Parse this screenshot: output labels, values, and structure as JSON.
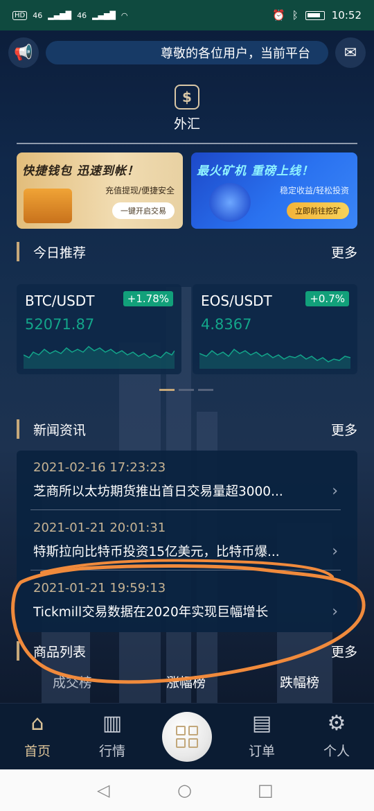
{
  "status_bar": {
    "left": [
      "HD",
      "46",
      "46"
    ],
    "time": "10:52"
  },
  "notice": {
    "text": "尊敬的各位用户，当前平台",
    "left_icon": "megaphone-icon",
    "right_icon": "mail-icon"
  },
  "forex": {
    "icon": "dollar-exchange-icon",
    "label": "外汇"
  },
  "banners": [
    {
      "headline": "快捷钱包 迅速到帐！",
      "subtitle": "充值提现/便捷安全",
      "cta": "一键开启交易"
    },
    {
      "headline": "最火矿机 重磅上线！",
      "subtitle": "稳定收益/轻松投资",
      "cta": "立即前往挖矿"
    }
  ],
  "recommend": {
    "title": "今日推荐",
    "more": "更多"
  },
  "tickers": [
    {
      "pair": "BTC/USDT",
      "change": "+1.78%",
      "price": "52071.87"
    },
    {
      "pair": "EOS/USDT",
      "change": "+0.7%",
      "price": "4.8367"
    }
  ],
  "news": {
    "title": "新闻资讯",
    "more": "更多",
    "items": [
      {
        "time": "2021-02-16 17:23:23",
        "headline": "芝商所以太坊期货推出首日交易量超3000..."
      },
      {
        "time": "2021-01-21 20:01:31",
        "headline": "特斯拉向比特币投资15亿美元，比特币爆..."
      },
      {
        "time": "2021-01-21 19:59:13",
        "headline": "Tickmill交易数据在2020年实现巨幅增长"
      }
    ]
  },
  "products": {
    "title": "商品列表",
    "more": "更多",
    "tabs": [
      "成交榜",
      "涨幅榜",
      "跌幅榜"
    ]
  },
  "tabbar": [
    {
      "label": "首页",
      "icon": "home-icon",
      "active": true
    },
    {
      "label": "行情",
      "icon": "chart-bars-icon",
      "active": false
    },
    {
      "label": "",
      "icon": "grid-icon",
      "active": false
    },
    {
      "label": "订单",
      "icon": "document-icon",
      "active": false
    },
    {
      "label": "个人",
      "icon": "user-settings-icon",
      "active": false
    }
  ],
  "colors": {
    "accent_gold": "#c6a87a",
    "up_green": "#12a07a",
    "status_bar": "#0f4a3f",
    "annotation": "#f08a3c"
  }
}
